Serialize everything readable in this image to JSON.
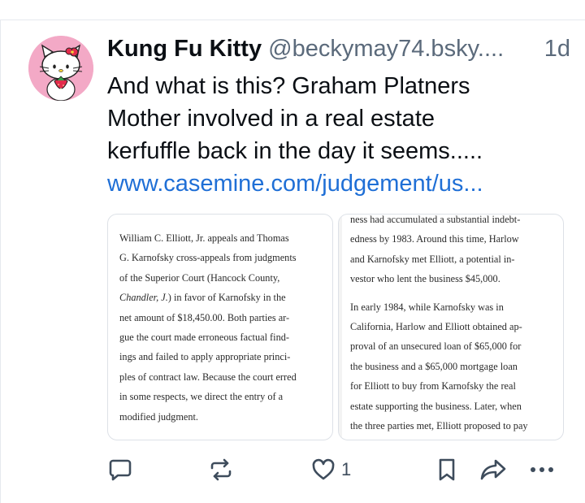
{
  "post": {
    "author_name": "Kung Fu Kitty",
    "handle": "@beckymay74.bsky....",
    "timestamp": "1d",
    "text_lines": [
      "And what is this? Graham Platners",
      "Mother involved in a real estate",
      "kerfuffle back in the day it seems....."
    ],
    "link_text": "www.casemine.com/judgement/us...",
    "like_count": "1"
  },
  "images": {
    "left": {
      "lines": [
        "William C. Elliott, Jr. appeals and Thomas",
        "G. Karnofsky cross-appeals from judgments",
        "of the Superior Court (Hancock County,",
        "Chandler, J.) in favor of Karnofsky in the",
        "net amount of $18,450.00. Both parties ar-",
        "gue the court made erroneous factual find-",
        "ings and failed to apply appropriate princi-",
        "ples of contract law. Because the court erred",
        "in some respects, we direct the entry of a",
        "modified judgment."
      ]
    },
    "right": {
      "lines": [
        "ness had accumulated a substantial indebt-",
        "edness by 1983. Around this time, Harlow",
        "and Karnofsky met Elliott, a potential in-",
        "vestor who lent the business $45,000.",
        "In early 1984, while Karnofsky was in",
        "California, Harlow and Elliott obtained ap-",
        "proval of an unsecured loan of $65,000 for",
        "the business and a $65,000 mortgage loan",
        "for Elliott to buy from Karnofsky the real",
        "estate supporting the business. Later, when",
        "the three parties met, Elliott proposed to pay"
      ]
    }
  },
  "icons": {
    "reply": "speech-bubble-icon",
    "repost": "repost-arrows-icon",
    "like": "heart-outline-icon",
    "bookmark": "bookmark-icon",
    "share": "share-arrow-icon",
    "more": "ellipsis-icon"
  },
  "colors": {
    "link": "#1f6fd6",
    "muted_text": "#5b6a7b",
    "primary_text": "#0b0f14",
    "avatar_bg": "#f3a9c6"
  }
}
